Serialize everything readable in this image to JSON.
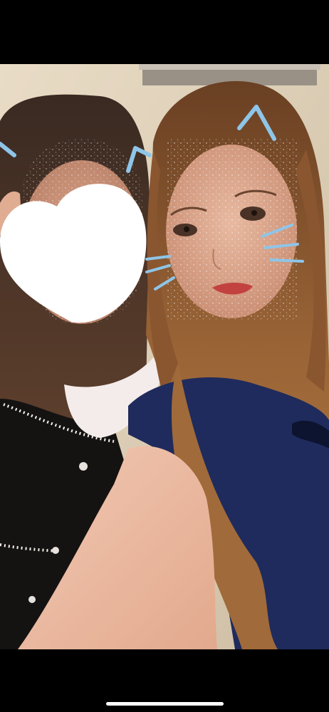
{
  "viewer": {
    "background": "#000000",
    "photo": {
      "subject": "selfie",
      "overlays": [
        "heart-sticker",
        "cat-ears-doodle",
        "whiskers-doodle",
        "glitter-face-filter"
      ],
      "doodle_color": "#8ec5e8",
      "sticker_color": "#ffffff"
    },
    "home_indicator_color": "#ffffff"
  }
}
